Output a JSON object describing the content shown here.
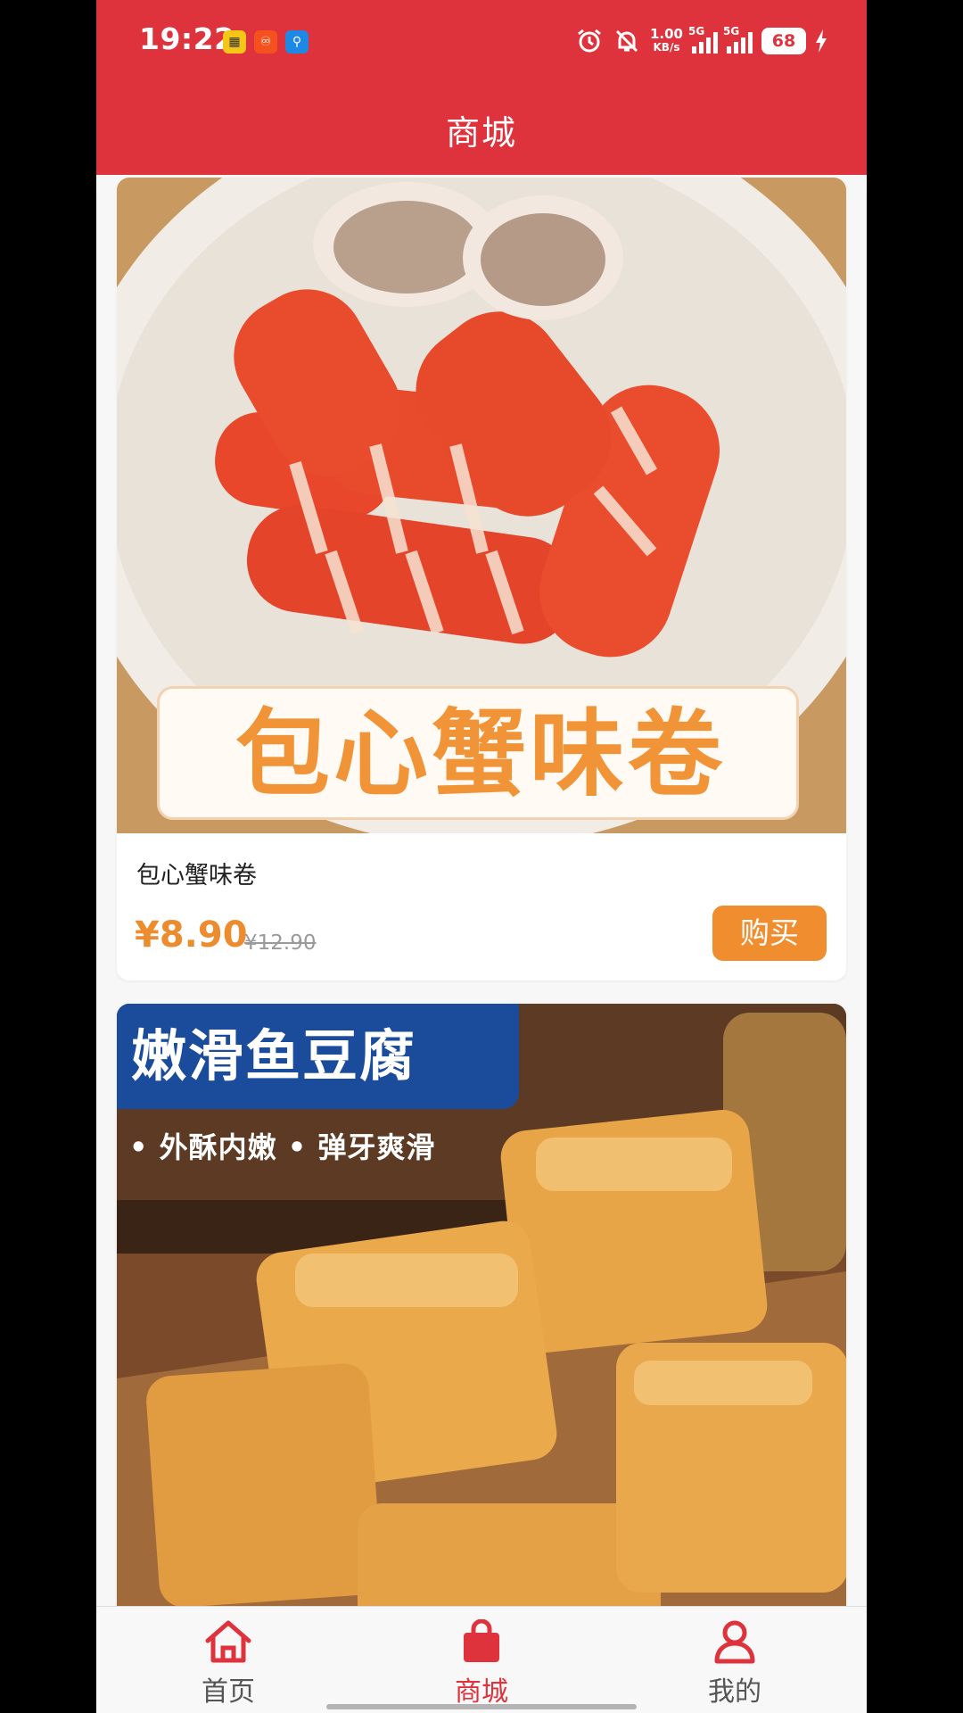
{
  "status_bar": {
    "time": "19:22",
    "net_speed_value": "1.00",
    "net_speed_unit": "KB/s",
    "sig1": "5G",
    "sig2": "5G",
    "battery": "68"
  },
  "header": {
    "title": "商城"
  },
  "products": [
    {
      "name": "包心蟹味卷",
      "price": "¥8.90",
      "original_price": "¥12.90",
      "buy_label": "购买",
      "image_banner": "包心蟹味卷"
    },
    {
      "image_banner": "嫩滑鱼豆腐",
      "image_tagline": "• 外酥内嫩  • 弹牙爽滑"
    }
  ],
  "nav": {
    "items": [
      {
        "label": "首页",
        "icon": "home-icon"
      },
      {
        "label": "商城",
        "icon": "shopping-bag-icon",
        "active": true
      },
      {
        "label": "我的",
        "icon": "user-icon"
      }
    ],
    "active_color": "#de323c",
    "inactive_color": "#555555"
  },
  "colors": {
    "header_bg": "#de323c",
    "price": "#ec8c2f",
    "buy_button": "#ef8d2f"
  }
}
